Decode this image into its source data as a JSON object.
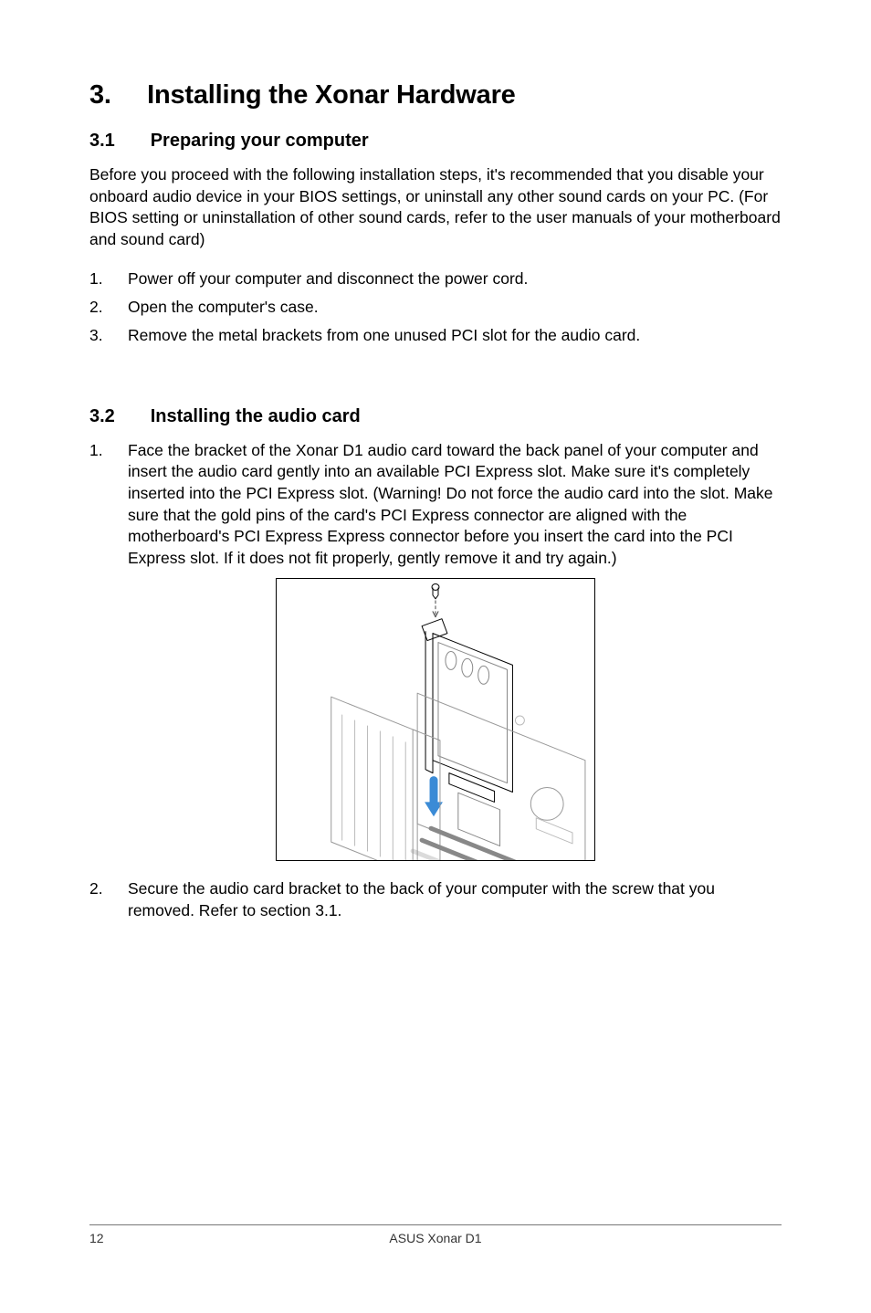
{
  "chapter": {
    "number": "3.",
    "title": "Installing the Xonar Hardware"
  },
  "section1": {
    "number": "3.1",
    "title": "Preparing your computer",
    "intro": "Before you proceed with the following installation steps, it's recommended that you disable your onboard audio device in your BIOS settings, or uninstall any other sound cards on your PC. (For BIOS setting or uninstallation of other sound cards, refer to the user manuals of your motherboard and sound card)",
    "steps": [
      {
        "n": "1.",
        "t": "Power off your computer and disconnect the power cord."
      },
      {
        "n": "2.",
        "t": "Open the computer's case."
      },
      {
        "n": "3.",
        "t": "Remove the metal brackets from one unused PCI slot for the audio card."
      }
    ]
  },
  "section2": {
    "number": "3.2",
    "title": "Installing the audio card",
    "steps": [
      {
        "n": "1.",
        "t": "Face the bracket of the Xonar D1 audio card toward the back panel of your computer and insert the audio card gently into an available PCI Express slot. Make sure it's completely inserted into the PCI Express slot. (Warning! Do not force the audio card into the slot. Make sure that the gold pins of the card's PCI Express connector are aligned with the motherboard's PCI Express Express connector before you insert the card into the PCI Express slot. If it does not fit properly, gently remove it and try again.)"
      },
      {
        "n": "2.",
        "t": "Secure the audio card bracket to the back of your computer with the screw that you removed. Refer to section 3.1."
      }
    ]
  },
  "footer": {
    "page": "12",
    "product": "ASUS Xonar D1"
  }
}
